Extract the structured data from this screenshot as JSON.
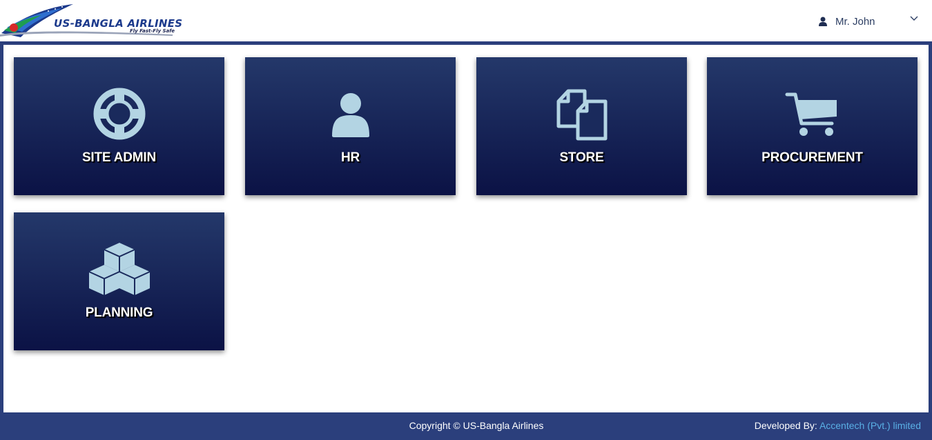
{
  "header": {
    "logo": {
      "name": "US-BANGLA AIRLINES",
      "tagline": "Fly Fast-Fly Safe"
    },
    "user": {
      "name": "Mr. John",
      "icon": "user-icon",
      "dropdown_icon": "chevron-down-icon"
    }
  },
  "modules": [
    {
      "label": "SITE ADMIN",
      "icon": "life-ring-icon"
    },
    {
      "label": "HR",
      "icon": "user-icon"
    },
    {
      "label": "STORE",
      "icon": "copy-documents-icon"
    },
    {
      "label": "PROCUREMENT",
      "icon": "shopping-cart-icon"
    },
    {
      "label": "PLANNING",
      "icon": "cubes-icon"
    }
  ],
  "footer": {
    "copyright": "Copyright © US-Bangla Airlines",
    "developed_by_label": "Developed By:",
    "developer": "Accentech (Pvt.) limited"
  },
  "colors": {
    "brand_navy": "#2b3f7c",
    "tile_top": "#24386a",
    "tile_bottom": "#0b1245",
    "icon": "#b3d4e3",
    "link": "#5ab0e6"
  }
}
